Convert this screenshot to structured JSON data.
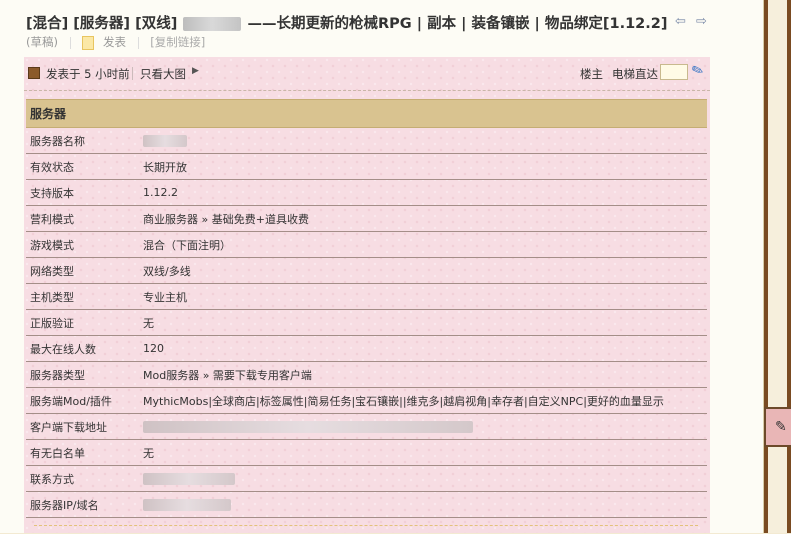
{
  "thread": {
    "title_prefix": "[混合] [服务器] [双线]",
    "title_main": "——长期更新的枪械RPG | 副本 | 装备镶嵌 | 物品绑定[1.12.2]",
    "nav_prev": "⇦",
    "nav_next": "⇨",
    "draft_label": "(草稿)",
    "publish_label": "发表",
    "copy_link_label": "[复制链接]"
  },
  "post": {
    "posted_time": "发表于 5 小时前",
    "only_author_label": "只看大图",
    "only_author_arrow": "▶",
    "floor_label": "楼主",
    "elevator_label": "电梯直达",
    "elevator_value": "",
    "elevator_go_icon": "✎"
  },
  "server_info": {
    "section_title": "服务器",
    "rows": [
      {
        "key": "服务器名称",
        "value": ""
      },
      {
        "key": "有效状态",
        "value": "长期开放"
      },
      {
        "key": "支持版本",
        "value": "1.12.2"
      },
      {
        "key": "营利模式",
        "value": "商业服务器 » 基础免费+道具收费"
      },
      {
        "key": "游戏模式",
        "value": "混合（下面注明）"
      },
      {
        "key": "网络类型",
        "value": "双线/多线"
      },
      {
        "key": "主机类型",
        "value": "专业主机"
      },
      {
        "key": "正版验证",
        "value": "无"
      },
      {
        "key": "最大在线人数",
        "value": "120"
      },
      {
        "key": "服务器类型",
        "value": "Mod服务器 » 需要下载专用客户端"
      },
      {
        "key": "服务端Mod/插件",
        "value": "MythicMobs|全球商店|标签属性|简易任务|宝石镶嵌||维克多|越肩视角|幸存者|自定义NPC|更好的血量显示"
      },
      {
        "key": "客户端下载地址",
        "value": ""
      },
      {
        "key": "有无白名单",
        "value": "无"
      },
      {
        "key": "联系方式",
        "value": ""
      },
      {
        "key": "服务器IP/域名",
        "value": ""
      }
    ]
  },
  "side_widget": {
    "icon": "✎"
  },
  "colors": {
    "post_bg": "#f7dde3",
    "section_header": "#d9c390",
    "row_border": "#a48e88",
    "link_blue": "#2f6fc2"
  }
}
